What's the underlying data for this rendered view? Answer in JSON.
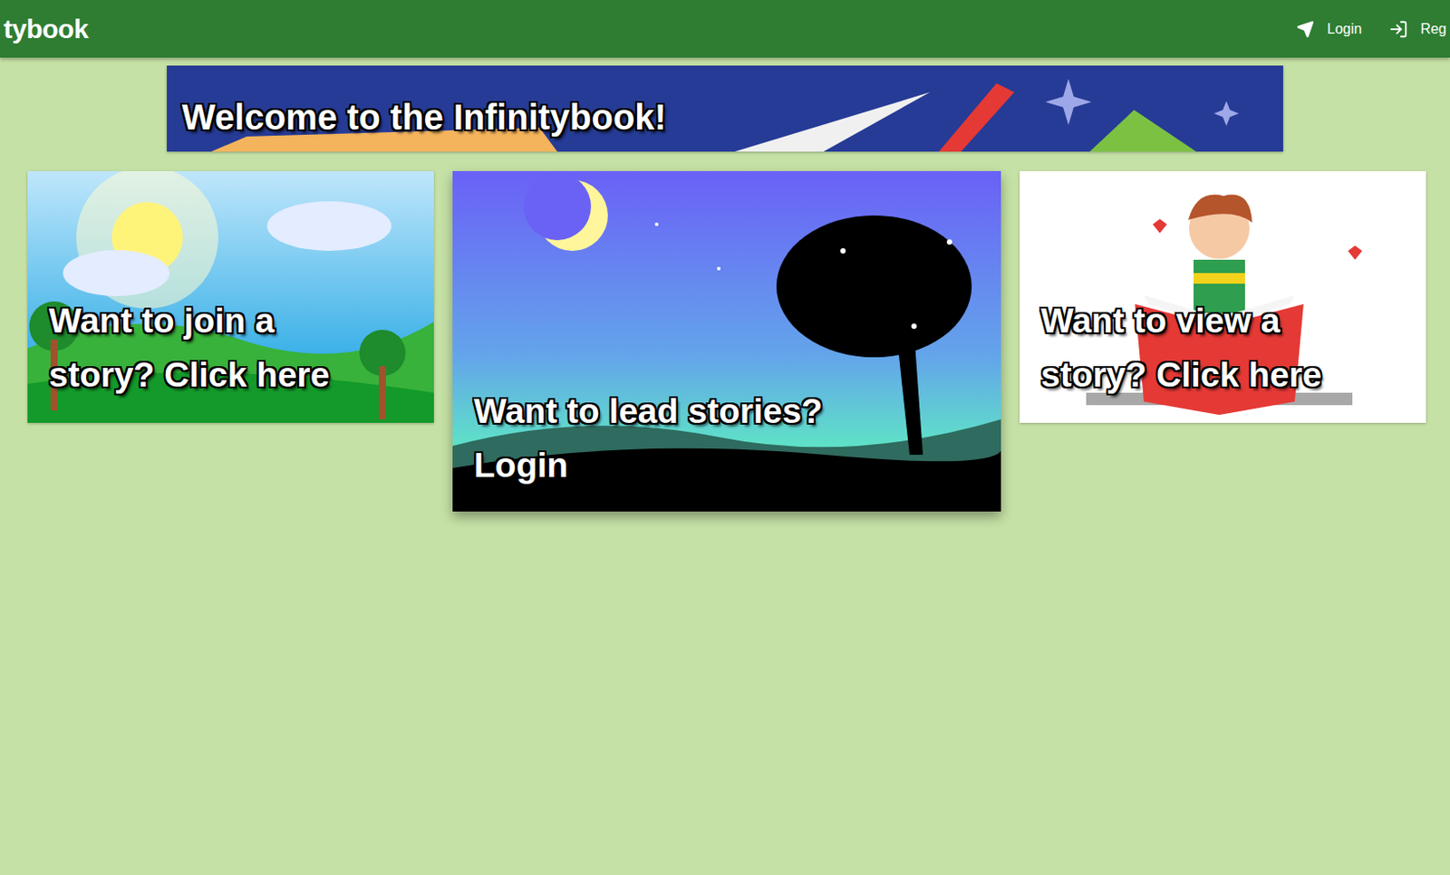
{
  "header": {
    "brand": "tybook",
    "nav": [
      {
        "label": "Login",
        "kind": "send"
      },
      {
        "label": "Reg",
        "kind": "enter"
      }
    ]
  },
  "banner": {
    "title": "Welcome to the Infinitybook!"
  },
  "cards": [
    {
      "lines": [
        "Want to join a",
        "story? Click here"
      ],
      "kind": "day",
      "featured": false
    },
    {
      "lines": [
        "Want to lead stories?",
        "Login"
      ],
      "kind": "night",
      "featured": true
    },
    {
      "lines": [
        "Want to view a",
        "story? Click here"
      ],
      "kind": "reader",
      "featured": false
    }
  ]
}
